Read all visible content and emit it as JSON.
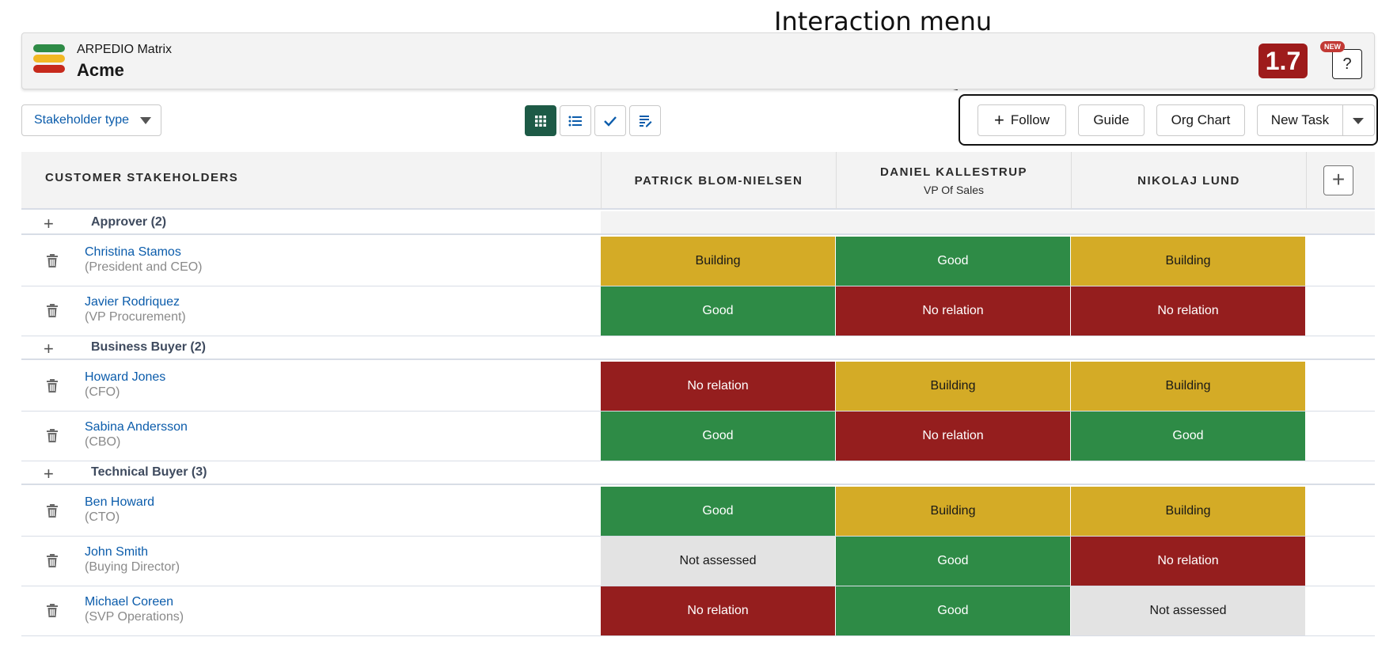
{
  "annotation": {
    "label": "Interaction menu"
  },
  "header": {
    "app_name": "ARPEDIO Matrix",
    "account": "Acme",
    "version": "1.7",
    "new_badge": "NEW",
    "help": "?"
  },
  "logo": {
    "colors": [
      "#2e8b46",
      "#f2b824",
      "#c72a1c"
    ]
  },
  "toolbar": {
    "filter_label": "Stakeholder type",
    "views": [
      "grid-icon",
      "list-icon",
      "check-icon",
      "edit-list-icon"
    ],
    "follow_label": "Follow",
    "guide_label": "Guide",
    "org_chart_label": "Org Chart",
    "new_task_label": "New Task"
  },
  "columns": {
    "stakeholders": "CUSTOMER STAKEHOLDERS",
    "people": [
      {
        "name": "PATRICK BLOM-NIELSEN",
        "title": ""
      },
      {
        "name": "DANIEL KALLESTRUP",
        "title": "VP Of Sales"
      },
      {
        "name": "NIKOLAJ LUND",
        "title": ""
      }
    ],
    "add": "+"
  },
  "status_colors": {
    "Good": "#2e8b46",
    "Building": "#d4ab26",
    "No relation": "#951e1e",
    "Not assessed": "#e3e3e3"
  },
  "groups": [
    {
      "label": "Approver (2)",
      "rows": [
        {
          "name": "Christina Stamos",
          "title": "(President and CEO)",
          "cells": [
            "Building",
            "Good",
            "Building"
          ]
        },
        {
          "name": "Javier Rodriquez",
          "title": "(VP Procurement)",
          "cells": [
            "Good",
            "No relation",
            "No relation"
          ]
        }
      ]
    },
    {
      "label": "Business Buyer (2)",
      "rows": [
        {
          "name": "Howard Jones",
          "title": "(CFO)",
          "cells": [
            "No relation",
            "Building",
            "Building"
          ]
        },
        {
          "name": "Sabina Andersson",
          "title": "(CBO)",
          "cells": [
            "Good",
            "No relation",
            "Good"
          ]
        }
      ]
    },
    {
      "label": "Technical Buyer (3)",
      "rows": [
        {
          "name": "Ben Howard",
          "title": "(CTO)",
          "cells": [
            "Good",
            "Building",
            "Building"
          ]
        },
        {
          "name": "John Smith",
          "title": "(Buying Director)",
          "cells": [
            "Not assessed",
            "Good",
            "No relation"
          ]
        },
        {
          "name": "Michael Coreen",
          "title": "(SVP Operations)",
          "cells": [
            "No relation",
            "Good",
            "Not assessed"
          ]
        }
      ]
    }
  ]
}
